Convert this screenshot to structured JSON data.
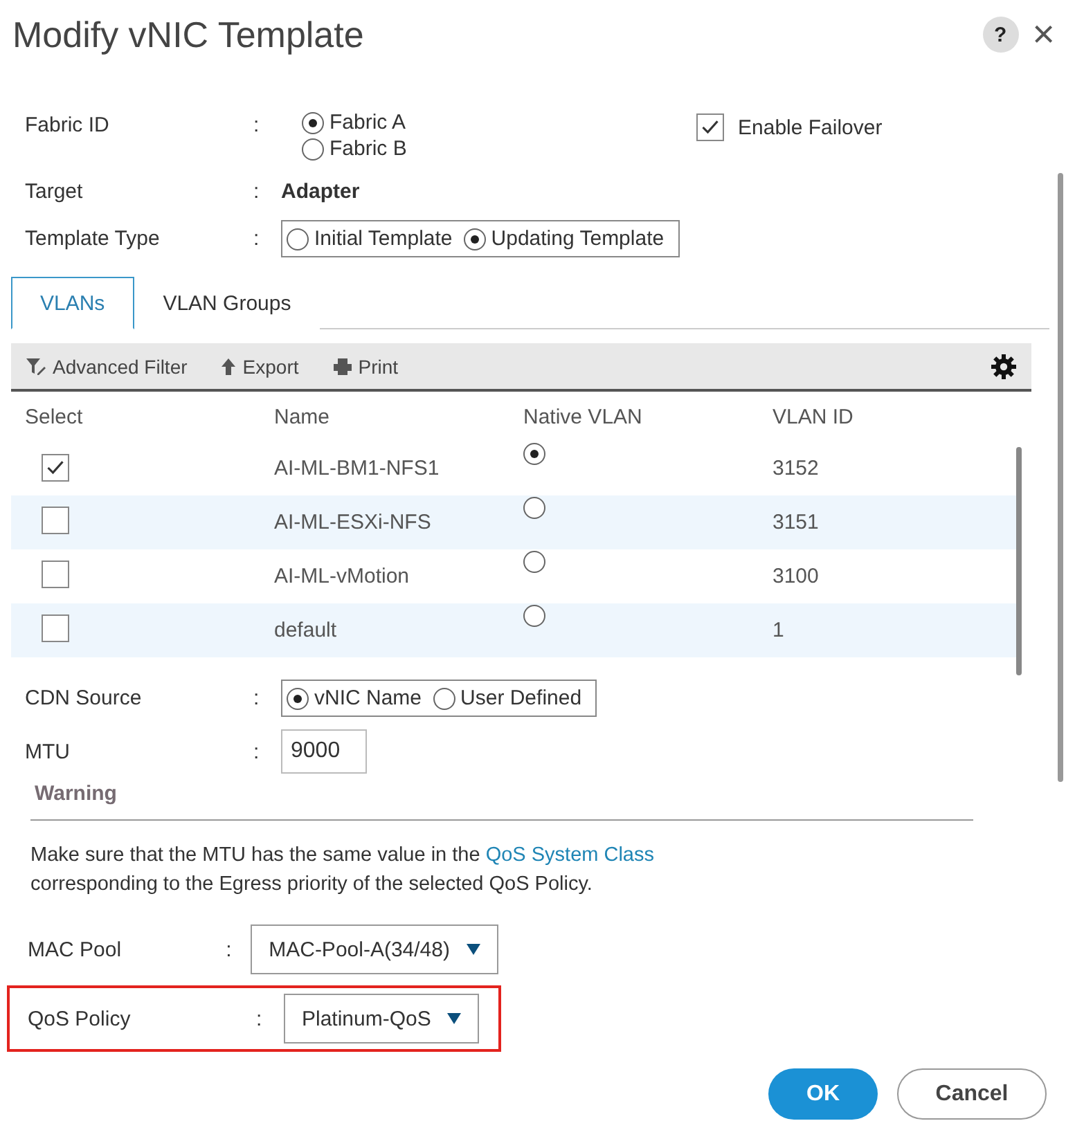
{
  "dialog": {
    "title": "Modify vNIC Template",
    "help": "?",
    "close": "×"
  },
  "fabric_id": {
    "label": "Fabric ID",
    "colon": ":",
    "options": [
      {
        "label": "Fabric A",
        "selected": true
      },
      {
        "label": "Fabric B",
        "selected": false
      }
    ]
  },
  "failover": {
    "label": "Enable Failover",
    "checked": true
  },
  "target": {
    "label": "Target",
    "colon": ":",
    "value": "Adapter"
  },
  "template_type": {
    "label": "Template Type",
    "colon": ":",
    "options": [
      {
        "label": "Initial Template",
        "selected": false
      },
      {
        "label": "Updating Template",
        "selected": true
      }
    ]
  },
  "tabs": [
    {
      "label": "VLANs",
      "selected": true
    },
    {
      "label": "VLAN Groups",
      "selected": false
    }
  ],
  "toolbar": [
    {
      "label": "Advanced Filter",
      "kind": "filter"
    },
    {
      "label": "Export",
      "kind": "export"
    },
    {
      "label": "Print",
      "kind": "print"
    }
  ],
  "table": {
    "columns": [
      "Select",
      "Name",
      "Native VLAN",
      "VLAN ID"
    ],
    "rows": [
      {
        "checked": true,
        "name": "AI-ML-BM1-NFS1",
        "native": true,
        "vlan_id": "3152"
      },
      {
        "checked": false,
        "name": "AI-ML-ESXi-NFS",
        "native": false,
        "vlan_id": "3151"
      },
      {
        "checked": false,
        "name": "AI-ML-vMotion",
        "native": false,
        "vlan_id": "3100"
      },
      {
        "checked": false,
        "name": "default",
        "native": false,
        "vlan_id": "1"
      }
    ]
  },
  "cdn_source": {
    "label": "CDN Source",
    "colon": ":",
    "options": [
      {
        "label": "vNIC Name",
        "selected": true
      },
      {
        "label": "User Defined",
        "selected": false
      }
    ]
  },
  "mtu": {
    "label": "MTU",
    "colon": ":",
    "value": "9000"
  },
  "warning": {
    "title": "Warning",
    "text_before": "Make sure that the MTU has the same value in the",
    "link": "QoS System Class",
    "text_after": "corresponding to the Egress priority of the selected QoS Policy."
  },
  "selects": [
    {
      "label": "MAC Pool",
      "colon": ":",
      "value": "MAC-Pool-A(34/48)",
      "highlighted": false
    },
    {
      "label": "QoS Policy",
      "colon": ":",
      "value": "Platinum-QoS",
      "highlighted": true
    }
  ],
  "buttons": [
    {
      "label": "OK",
      "kind": "primary"
    },
    {
      "label": "Cancel",
      "kind": "secondary"
    }
  ]
}
